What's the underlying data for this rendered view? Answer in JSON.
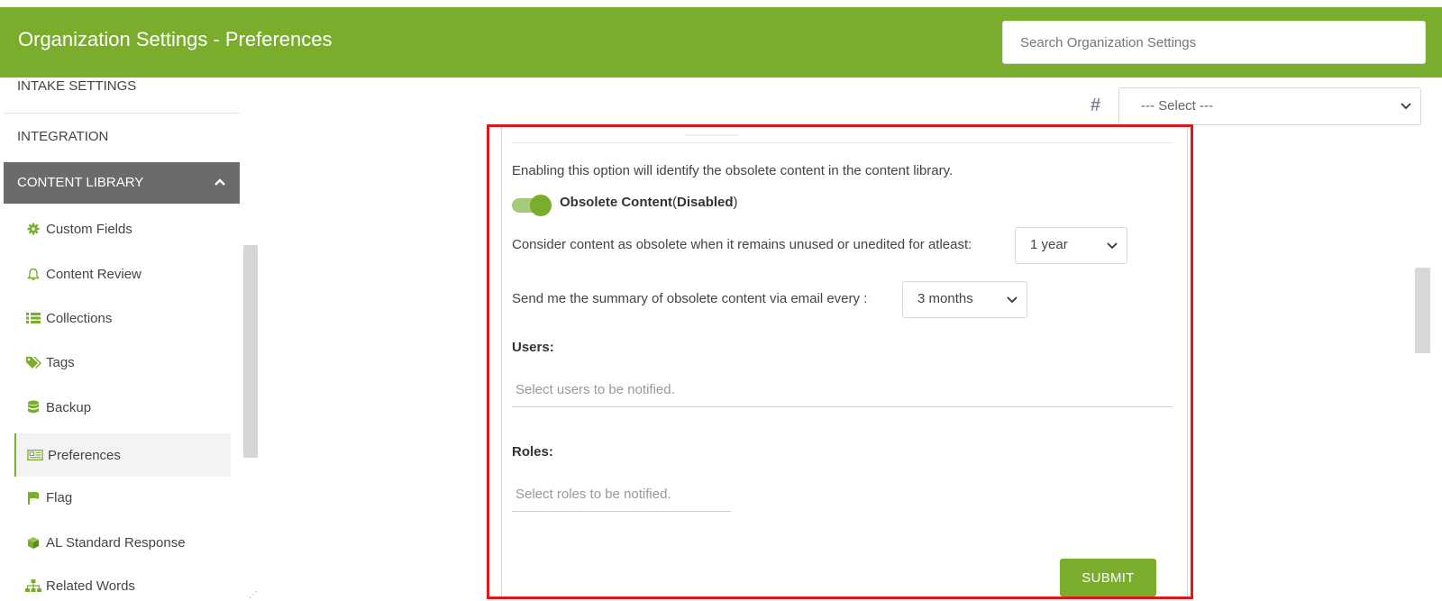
{
  "header": {
    "title": "Organization Settings - Preferences",
    "search_placeholder": "Search Organization Settings"
  },
  "sidebar": {
    "sections": {
      "intake": "INTAKE SETTINGS",
      "integration": "INTEGRATION",
      "content_library": "CONTENT LIBRARY"
    },
    "items": [
      {
        "label": "Custom Fields",
        "icon": "gear-icon"
      },
      {
        "label": "Content Review",
        "icon": "bell-icon"
      },
      {
        "label": "Collections",
        "icon": "list-icon"
      },
      {
        "label": "Tags",
        "icon": "tags-icon"
      },
      {
        "label": "Backup",
        "icon": "database-icon"
      },
      {
        "label": "Preferences",
        "icon": "newspaper-icon",
        "active": true
      },
      {
        "label": "Flag",
        "icon": "flag-icon"
      },
      {
        "label": "AL Standard Response",
        "icon": "cube-icon"
      },
      {
        "label": "Related Words",
        "icon": "sitemap-icon"
      }
    ]
  },
  "top_select": {
    "value": "--- Select ---",
    "icon": "hash-icon"
  },
  "obsolete": {
    "description": "Enabling this option will identify the obsolete content in the content library.",
    "toggle_label_bold": "Obsolete Content",
    "toggle_paren_open": "(",
    "toggle_status": "Disabled",
    "toggle_paren_close": ")",
    "toggle_on": true,
    "threshold_label": "Consider content as obsolete when it remains unused or unedited for atleast:",
    "threshold_value": "1 year",
    "email_label": "Send me the summary of obsolete content via email every :",
    "email_value": "3 months",
    "users_label": "Users:",
    "users_placeholder": "Select users to be notified.",
    "roles_label": "Roles:",
    "roles_placeholder": "Select roles to be notified.",
    "submit_label": "SUBMIT"
  },
  "colors": {
    "brand_green": "#7aad2c",
    "highlight_red": "#e0161b",
    "sidebar_active_bg": "#6b6b6b"
  }
}
